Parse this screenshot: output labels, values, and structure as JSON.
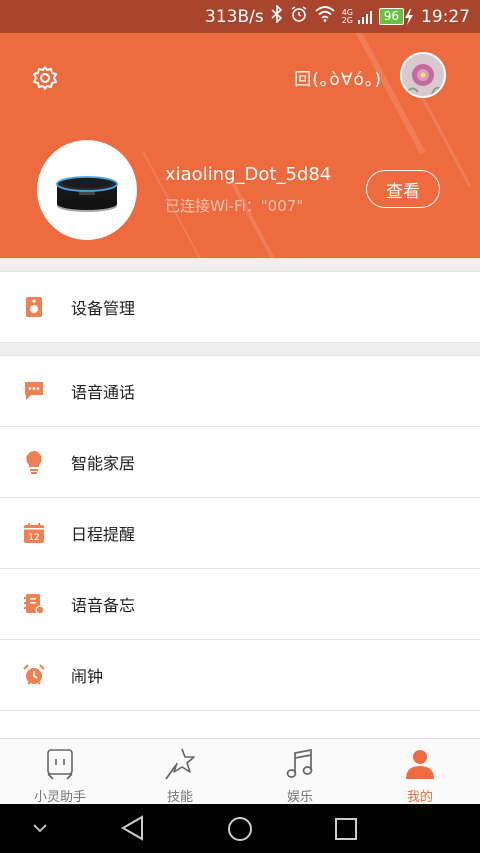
{
  "status_bar": {
    "speed": "313B/s",
    "network": "4G 2G",
    "battery": "96",
    "time": "19:27"
  },
  "header": {
    "nickname": "回(｡ò∀ó｡)",
    "device_name": "xiaoling_Dot_5d84",
    "wifi_status": "已连接Wi-Fi：\"007\"",
    "view_button": "查看",
    "accent_color": "#ee6a3f"
  },
  "menu": {
    "device_management": "设备管理",
    "voice_call": "语音通话",
    "smart_home": "智能家居",
    "schedule_reminder": "日程提醒",
    "voice_memo": "语音备忘",
    "alarm": "闹钟",
    "calendar_day": "12"
  },
  "tabs": {
    "assistant": "小灵助手",
    "skills": "技能",
    "entertainment": "娱乐",
    "mine": "我的",
    "active": "mine"
  }
}
